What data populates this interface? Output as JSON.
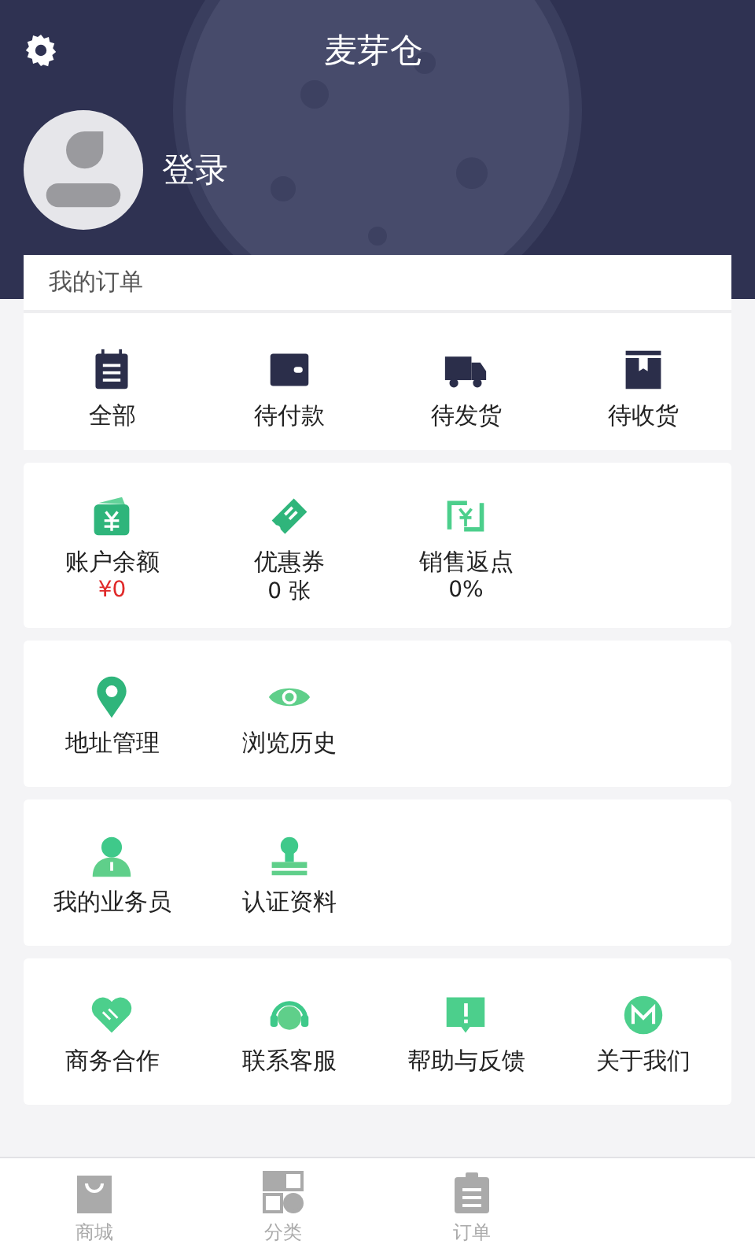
{
  "header": {
    "title": "麦芽仓",
    "login": "登录"
  },
  "orders": {
    "title": "我的订单",
    "items": [
      {
        "label": "全部"
      },
      {
        "label": "待付款"
      },
      {
        "label": "待发货"
      },
      {
        "label": "待收货"
      }
    ]
  },
  "assets": [
    {
      "label": "账户余额",
      "value": "¥0",
      "emphasis": true
    },
    {
      "label": "优惠券",
      "value": "0 张",
      "emphasis": false
    },
    {
      "label": "销售返点",
      "value": "0%",
      "emphasis": false
    }
  ],
  "sections": [
    {
      "items": [
        {
          "label": "地址管理"
        },
        {
          "label": "浏览历史"
        }
      ]
    },
    {
      "items": [
        {
          "label": "我的业务员"
        },
        {
          "label": "认证资料"
        }
      ]
    },
    {
      "items": [
        {
          "label": "商务合作"
        },
        {
          "label": "联系客服"
        },
        {
          "label": "帮助与反馈"
        },
        {
          "label": "关于我们"
        }
      ]
    }
  ],
  "tab_bar": [
    {
      "label": "商城",
      "selected": false
    },
    {
      "label": "分类",
      "selected": false
    },
    {
      "label": "订单",
      "selected": false
    }
  ]
}
